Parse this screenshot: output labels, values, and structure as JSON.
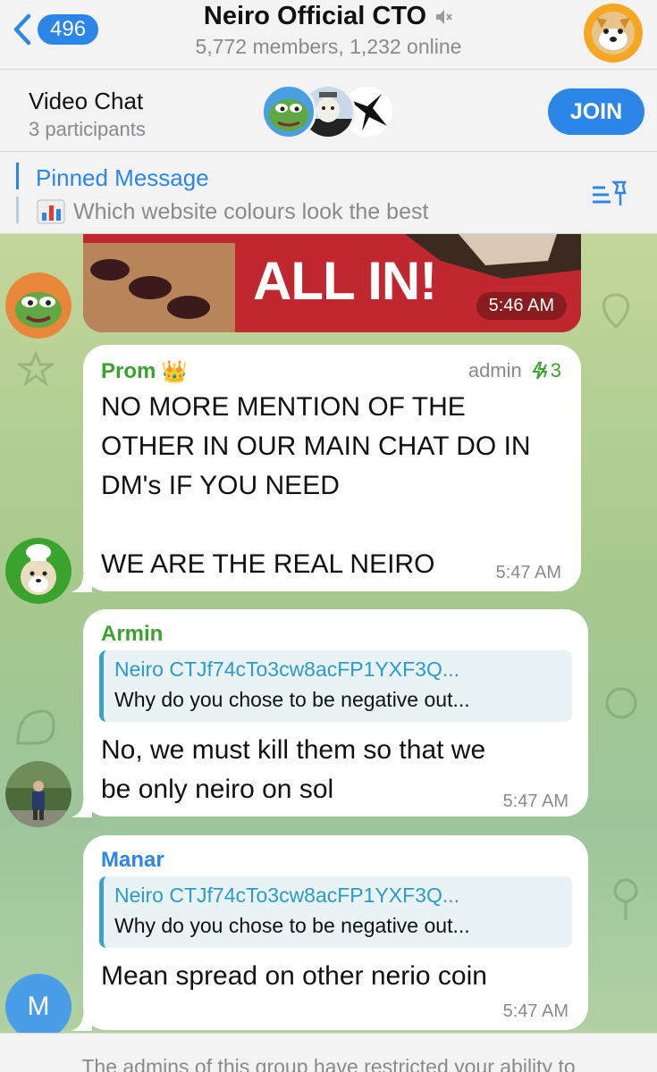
{
  "header": {
    "back_badge": "496",
    "title": "Neiro Official CTO",
    "subtitle": "5,772 members, 1,232 online"
  },
  "video_chat": {
    "title": "Video Chat",
    "subtitle": "3 participants",
    "join_label": "JOIN"
  },
  "pinned": {
    "title": "Pinned Message",
    "text": "Which website colours look the best"
  },
  "messages": {
    "image": {
      "caption": "ALL IN!",
      "time": "5:46 AM"
    },
    "prom": {
      "sender": "Prom",
      "crown": "👑",
      "role": "admin",
      "boost": "3",
      "text": "NO MORE MENTION OF THE\nOTHER IN OUR MAIN CHAT DO IN\nDM's IF YOU NEED\n\nWE ARE THE REAL NEIRO",
      "time": "5:47 AM"
    },
    "armin": {
      "sender": "Armin",
      "reply_name": "Neiro CTJf74cTo3cw8acFP1YXF3Q...",
      "reply_text": "Why do you chose to be negative out...",
      "text": "No, we must kill them so that we\nbe only neiro on sol",
      "time": "5:47 AM"
    },
    "manar": {
      "sender": "Manar",
      "avatar_letter": "M",
      "reply_name": "Neiro CTJf74cTo3cw8acFP1YXF3Q...",
      "reply_text": "Why do you chose to be negative out...",
      "text": "Mean spread on other nerio coin",
      "time": "5:47 AM"
    }
  },
  "footer": {
    "text": "The admins of this group have restricted your ability to"
  },
  "colors": {
    "accent": "#2b86e8",
    "prom_name": "#3aa32e",
    "armin_name": "#3aa32e",
    "manar_name": "#2b86e8",
    "reply_accent": "#3aa2c9"
  }
}
